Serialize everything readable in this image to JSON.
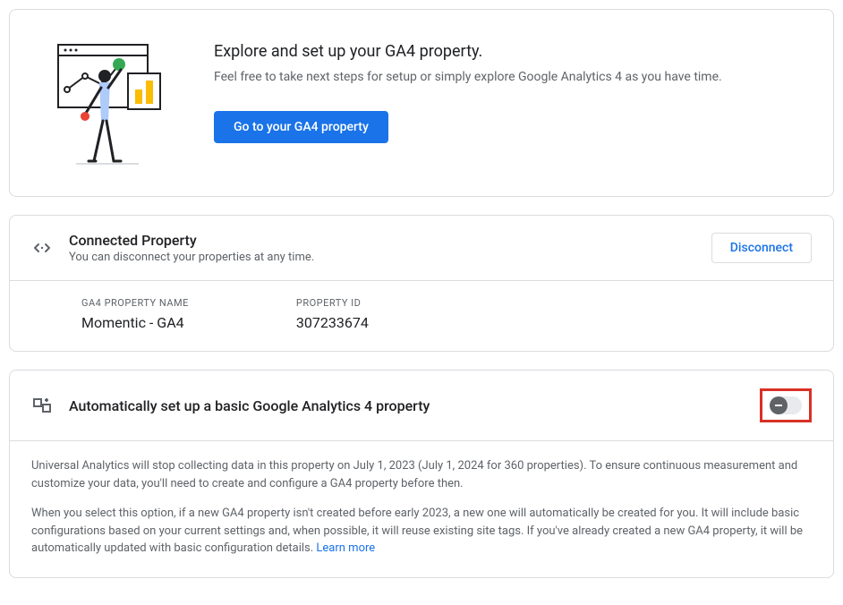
{
  "explore": {
    "title": "Explore and set up your GA4 property.",
    "subtitle": "Feel free to take next steps for setup or simply explore Google Analytics 4 as you have time.",
    "button": "Go to your GA4 property"
  },
  "connected": {
    "title": "Connected Property",
    "subtitle": "You can disconnect your properties at any time.",
    "disconnect_button": "Disconnect",
    "property_name_label": "GA4 PROPERTY NAME",
    "property_name_value": "Momentic - GA4",
    "property_id_label": "PROPERTY ID",
    "property_id_value": "307233674"
  },
  "auto": {
    "title": "Automatically set up a basic Google Analytics 4 property",
    "toggle_state": "off",
    "paragraph1": "Universal Analytics will stop collecting data in this property on July 1, 2023 (July 1, 2024 for 360 properties). To ensure continuous measurement and customize your data, you'll need to create and configure a GA4 property before then.",
    "paragraph2": "When you select this option, if a new GA4 property isn't created before early 2023, a new one will automatically be created for you. It will include basic configurations based on your current settings and, when possible, it will reuse existing site tags. If you've already created a new GA4 property, it will be automatically updated with basic configuration details. ",
    "learn_more": "Learn more"
  }
}
